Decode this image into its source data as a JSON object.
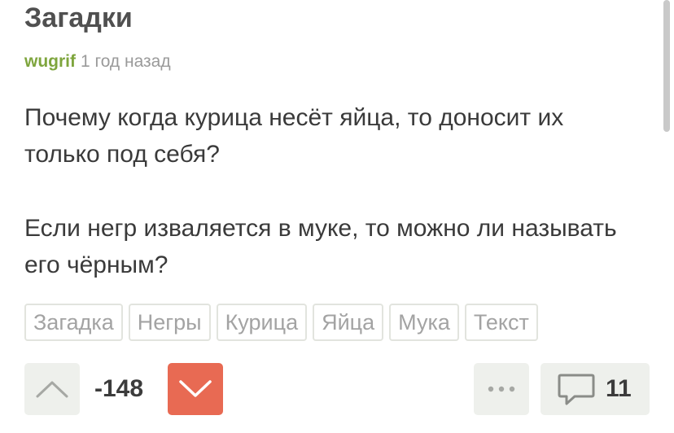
{
  "post": {
    "title": "Загадки",
    "author": "wugrif",
    "time": "1 год назад",
    "paragraphs": [
      [
        "Почему когда курица несёт яйца, то доносит их",
        "только под себя?"
      ],
      [
        "Если негр изваляется в муке, то можно ли называть",
        "его чёрным?"
      ]
    ]
  },
  "tags": [
    "Загадка",
    "Негры",
    "Курица",
    "Яйца",
    "Мука",
    "Текст"
  ],
  "actions": {
    "upvote_icon": "chevron-up-icon",
    "downvote_icon": "chevron-down-icon",
    "more_icon": "more-dots-icon",
    "comments_icon": "speech-bubble-icon",
    "rating": "-148",
    "comments_count": "11"
  },
  "colors": {
    "author": "#7ea53d",
    "downvote_active": "#e86a53",
    "button_bg": "#eef0ec"
  }
}
